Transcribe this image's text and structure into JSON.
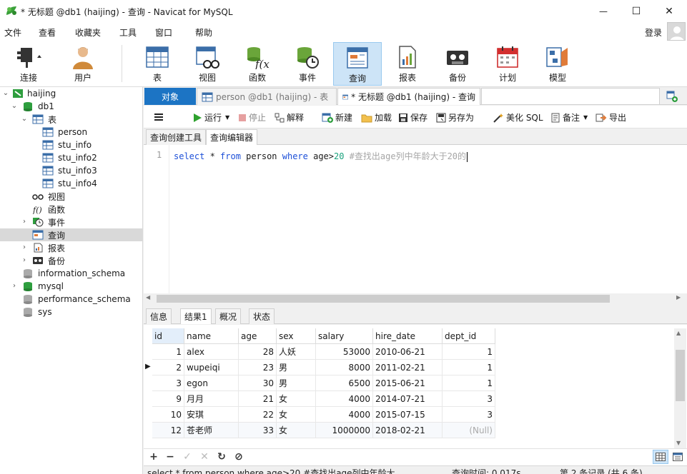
{
  "window": {
    "title": "* 无标题 @db1 (haijing) - 查询 - Navicat for MySQL",
    "minimize": "—",
    "maximize": "☐",
    "close": "✕"
  },
  "menu": {
    "items": [
      "文件",
      "查看",
      "收藏夹",
      "工具",
      "窗口",
      "帮助"
    ],
    "login": "登录"
  },
  "toolbar": {
    "items": [
      {
        "label": "连接",
        "icon": "plug-icon"
      },
      {
        "label": "用户",
        "icon": "user-icon"
      },
      {
        "label": "表",
        "icon": "table-icon"
      },
      {
        "label": "视图",
        "icon": "view-icon"
      },
      {
        "label": "函数",
        "icon": "function-icon"
      },
      {
        "label": "事件",
        "icon": "event-icon"
      },
      {
        "label": "查询",
        "icon": "query-icon",
        "active": true
      },
      {
        "label": "报表",
        "icon": "report-icon"
      },
      {
        "label": "备份",
        "icon": "backup-icon"
      },
      {
        "label": "计划",
        "icon": "schedule-icon"
      },
      {
        "label": "模型",
        "icon": "model-icon"
      }
    ]
  },
  "tree": {
    "connection": "haijing",
    "database": "db1",
    "tables_group": "表",
    "tables": [
      "person",
      "stu_info",
      "stu_info2",
      "stu_info3",
      "stu_info4"
    ],
    "views": "视图",
    "functions": "函数",
    "events": "事件",
    "queries": "查询",
    "reports": "报表",
    "backups": "备份",
    "other_dbs": [
      "information_schema",
      "mysql",
      "performance_schema",
      "sys"
    ]
  },
  "tabs": {
    "objects": "对象",
    "person": "person @db1 (haijing) - 表",
    "query": "* 无标题 @db1 (haijing) - 查询"
  },
  "query_toolbar": {
    "run": "运行",
    "stop": "停止",
    "explain": "解释",
    "new": "新建",
    "load": "加载",
    "save": "保存",
    "save_as": "另存为",
    "beautify": "美化 SQL",
    "comment": "备注",
    "export": "导出"
  },
  "sub_tabs": {
    "builder": "查询创建工具",
    "editor": "查询编辑器"
  },
  "editor": {
    "line_number": "1",
    "kw_select": "select",
    "star": " * ",
    "kw_from": "from",
    "table": " person ",
    "kw_where": "where",
    "condition": " age>",
    "number": "20",
    "comment": " #查找出age列中年龄大于20的"
  },
  "result_tabs": {
    "info": "信息",
    "result1": "结果1",
    "profile": "概况",
    "status": "状态"
  },
  "grid": {
    "columns": [
      "id",
      "name",
      "age",
      "sex",
      "salary",
      "hire_date",
      "dept_id"
    ],
    "rows": [
      [
        "1",
        "alex",
        "28",
        "人妖",
        "53000",
        "2010-06-21",
        "1"
      ],
      [
        "2",
        "wupeiqi",
        "23",
        "男",
        "8000",
        "2011-02-21",
        "1"
      ],
      [
        "3",
        "egon",
        "30",
        "男",
        "6500",
        "2015-06-21",
        "1"
      ],
      [
        "9",
        "月月",
        "21",
        "女",
        "4000",
        "2014-07-21",
        "3"
      ],
      [
        "10",
        "安琪",
        "22",
        "女",
        "4000",
        "2015-07-15",
        "3"
      ],
      [
        "12",
        "苍老师",
        "33",
        "女",
        "1000000",
        "2018-02-21",
        "(Null)"
      ]
    ]
  },
  "grid_toolbar": {
    "add": "+",
    "remove": "−",
    "apply": "✓",
    "discard": "✕",
    "refresh": "↻",
    "stop": "⊘"
  },
  "status": {
    "sql": "select * from person where age>20 #查找出age列中年龄大",
    "time": "查询时间: 0.017s",
    "records": "第 2 条记录 (共 6 条)"
  },
  "colors": {
    "accent_tab": "#1c74c4",
    "active_tool": "#cde4f7",
    "keyword": "#1c4fd8",
    "number": "#1aa27d",
    "comment": "#a6a6a6",
    "db_green": "#2e9e3e"
  }
}
